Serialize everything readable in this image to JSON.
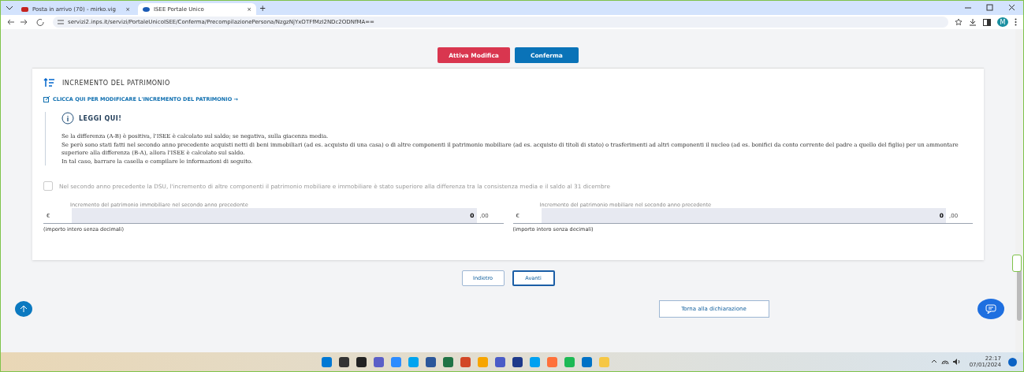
{
  "browser": {
    "tabs": [
      {
        "label": "Posta in arrivo (70) - mirko.vig",
        "selected": false,
        "close": "×"
      },
      {
        "label": "ISEE Portale Unico",
        "selected": true,
        "close": "×"
      }
    ],
    "new_tab": "+",
    "url": "servizi2.inps.it/servizi/PortaleUnicoISEE/Conferma/PrecompilazionePersona/NzgzNjYxOTFfMzI2NDc2ODNfMA==",
    "avatar": "M"
  },
  "actions": [
    {
      "label": "Attiva Modifica",
      "kind": "danger"
    },
    {
      "label": "Conferma",
      "kind": "primary"
    }
  ],
  "section": {
    "title": "INCREMENTO DEL PATRIMONIO",
    "edit_link": "CLICCA QUI PER MODIFICARE L'INCREMENTO DEL PATRIMONIO",
    "arrow": "→",
    "notice": {
      "title": "LEGGI QUI!",
      "lines": [
        "Se la differenza (A-B) è positiva, l'ISEE è calcolato sul saldo; se negativa, sulla giacenza media.",
        "Se però sono stati fatti nel secondo anno precedente acquisti netti di beni immobiliari (ad es. acquisto di una casa) o di altre componenti il patrimonio mobiliare (ad es. acquisto di titoli di stato) o trasferimenti ad altri componenti il nucleo (ad es. bonifici da conto corrente del padre a quello del figlio) per un ammontare superiore alla differenza (B-A), allora l'ISEE è calcolato sul saldo.",
        "In tal caso, barrare la casella e compilare le informazioni di seguito."
      ]
    },
    "checkbox": {
      "label": "Nel secondo anno precedente la DSU, l'incremento di altre componenti il patrimonio mobiliare e immobiliare è stato superiore alla differenza tra la consistenza media e il saldo al 31 dicembre",
      "checked": false
    },
    "fields": [
      {
        "label": "Incremento del patrimonio immobiliare nel secondo anno precedente",
        "currency": "€",
        "value": "0",
        "decimals": ",00",
        "hint": "(importo intero senza decimali)"
      },
      {
        "label": "Incremento del patrimonio mobiliare nel secondo anno precedente",
        "currency": "€",
        "value": "0",
        "decimals": ",00",
        "hint": "(importo intero senza decimali)"
      }
    ]
  },
  "nav": [
    {
      "label": "Indietro",
      "selected": false
    },
    {
      "label": "Avanti",
      "selected": true
    }
  ],
  "back_to": "Torna alla dichiarazione",
  "taskbar": {
    "time": "22:17",
    "date": "07/01/2024",
    "apps": [
      {
        "color": "#0078d4"
      },
      {
        "color": "#333333"
      },
      {
        "color": "#222222"
      },
      {
        "color": "#5b5fc7"
      },
      {
        "color": "#2d8cff"
      },
      {
        "color": "#00a4ef"
      },
      {
        "color": "#2b579a"
      },
      {
        "color": "#217346"
      },
      {
        "color": "#d24726"
      },
      {
        "color": "#f7a500"
      },
      {
        "color": "#4a5cc7"
      },
      {
        "color": "#1e3a8a"
      },
      {
        "color": "#00a1f1"
      },
      {
        "color": "#ff7139"
      },
      {
        "color": "#1db954"
      },
      {
        "color": "#0072c6"
      },
      {
        "color": "#f6c744"
      }
    ]
  }
}
